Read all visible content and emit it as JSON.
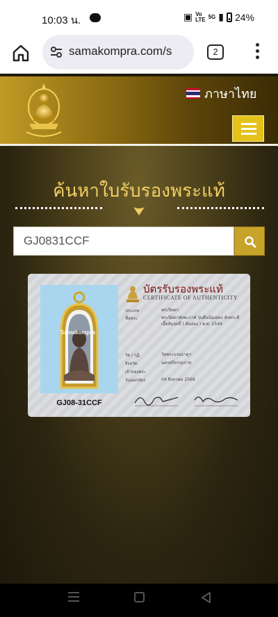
{
  "status_bar": {
    "time": "10:03 น.",
    "battery": "24%",
    "network": "5G"
  },
  "browser": {
    "url": "samakompra.com/s",
    "tab_count": "2"
  },
  "header": {
    "language_label": "ภาษาไทย"
  },
  "search": {
    "title": "ค้นหาใบรับรองพระแท้",
    "value": "GJ0831CCF"
  },
  "certificate": {
    "title_th": "บัตรรับรองพระแท้",
    "title_en": "CERTIFICATE OF AUTHENTICITY",
    "watermark": "Samakompra",
    "code": "GJ08-31CCF",
    "fields": [
      {
        "label": "ประเภท",
        "value": "พระปิดตา"
      },
      {
        "label": "ชื่อพระ",
        "value": "พระปิดตาพังพะกาฬ รุ่นคืนน้องสอง ลักพระดี เนื้อสัมฤทธิ์ ( ต้นอ่อง ) พ.ศ. 2544"
      },
      {
        "label": "วัด / กุฏิ",
        "value": "วัดพระบรมธาตุฯ"
      },
      {
        "label": "จังหวัด",
        "value": "นครศรีธรรมราช"
      },
      {
        "label": "เจ้าของพระ",
        "value": "-"
      },
      {
        "label": "วันออกบัตร",
        "value": "04 สิงหาคม 2569"
      }
    ]
  },
  "colors": {
    "accent_gold": "#e5c21a",
    "title_gold": "#f0cf64",
    "search_button": "#c8a32a"
  }
}
